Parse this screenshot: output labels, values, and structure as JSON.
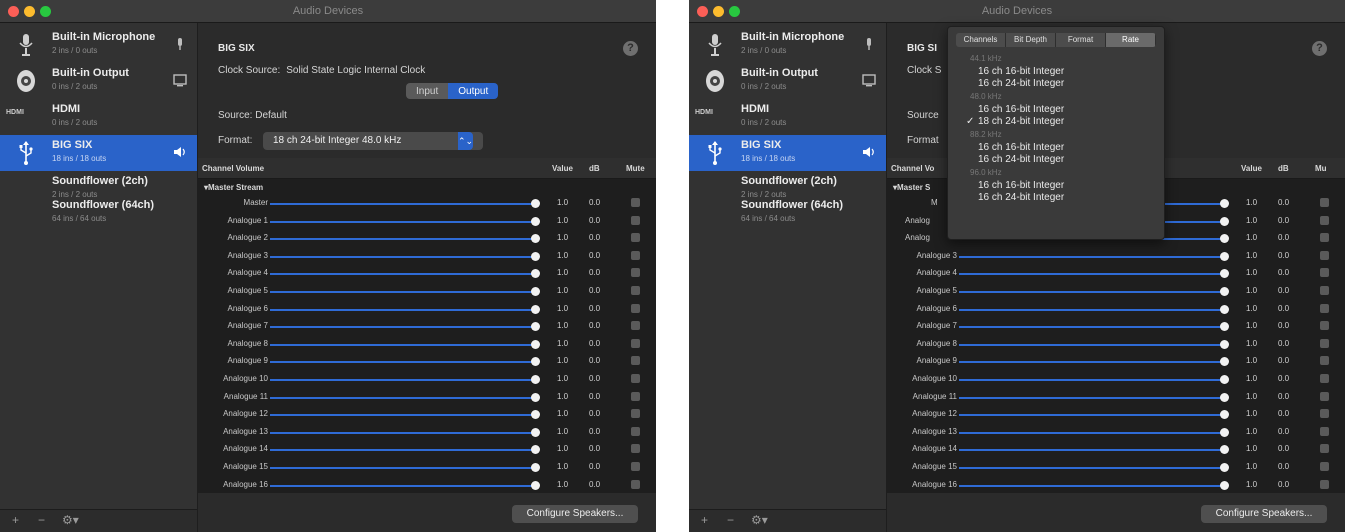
{
  "window_title": "Audio Devices",
  "devices": [
    {
      "name": "Built-in Microphone",
      "sub": "2 ins / 0 outs",
      "icon": "microphone-icon",
      "indicator": "mic-indicator-icon"
    },
    {
      "name": "Built-in Output",
      "sub": "0 ins / 2 outs",
      "icon": "speaker-icon",
      "indicator": "screen-indicator-icon"
    },
    {
      "name": "HDMI",
      "sub": "0 ins / 2 outs",
      "icon": "hdmi-icon",
      "icon_text": "HDMI"
    },
    {
      "name": "BIG SIX",
      "sub": "18 ins / 18 outs",
      "icon": "usb-icon",
      "indicator": "speaker-indicator-icon",
      "selected": true
    },
    {
      "name": "Soundflower (2ch)",
      "sub": "2 ins / 2 outs"
    },
    {
      "name": "Soundflower (64ch)",
      "sub": "64 ins / 64 outs"
    }
  ],
  "sidebar_bottom": {
    "add": "+",
    "remove": "−",
    "gear": "⚙▾"
  },
  "detail": {
    "device_title": "BIG SIX",
    "title_partial": "BIG SI",
    "help": "?",
    "clock_label": "Clock Source:",
    "clock_value": "Solid State Logic Internal Clock",
    "clock_partial": "Clock S",
    "tab_input": "Input",
    "tab_output": "Output",
    "source_label": "Source:",
    "source_value": "Default",
    "source_partial": "Source",
    "format_label": "Format:",
    "format_partial": "Format",
    "format_value": "18 ch 24-bit Integer 48.0 kHz",
    "format_arrow": "⌃⌄"
  },
  "table": {
    "col_channel": "Channel Volume",
    "col_channel_partial": "Channel Vo",
    "col_value": "Value",
    "col_db": "dB",
    "col_mute": "Mute",
    "col_mute_partial": "Mu",
    "group": "▾Master Stream",
    "group_partial": "▾Master S",
    "rows": [
      {
        "name": "Master",
        "value": "1.0",
        "db": "0.0",
        "partial": "M"
      },
      {
        "name": "Analogue 1",
        "value": "1.0",
        "db": "0.0",
        "partial": "Analog"
      },
      {
        "name": "Analogue 2",
        "value": "1.0",
        "db": "0.0",
        "partial": "Analog"
      },
      {
        "name": "Analogue 3",
        "value": "1.0",
        "db": "0.0"
      },
      {
        "name": "Analogue 4",
        "value": "1.0",
        "db": "0.0"
      },
      {
        "name": "Analogue 5",
        "value": "1.0",
        "db": "0.0"
      },
      {
        "name": "Analogue 6",
        "value": "1.0",
        "db": "0.0"
      },
      {
        "name": "Analogue 7",
        "value": "1.0",
        "db": "0.0"
      },
      {
        "name": "Analogue 8",
        "value": "1.0",
        "db": "0.0"
      },
      {
        "name": "Analogue 9",
        "value": "1.0",
        "db": "0.0"
      },
      {
        "name": "Analogue 10",
        "value": "1.0",
        "db": "0.0"
      },
      {
        "name": "Analogue 11",
        "value": "1.0",
        "db": "0.0"
      },
      {
        "name": "Analogue 12",
        "value": "1.0",
        "db": "0.0"
      },
      {
        "name": "Analogue 13",
        "value": "1.0",
        "db": "0.0"
      },
      {
        "name": "Analogue 14",
        "value": "1.0",
        "db": "0.0"
      },
      {
        "name": "Analogue 15",
        "value": "1.0",
        "db": "0.0"
      },
      {
        "name": "Analogue 16",
        "value": "1.0",
        "db": "0.0"
      }
    ],
    "volume_level": 1.0
  },
  "configure_button": "Configure Speakers...",
  "format_menu": {
    "tabs": [
      "Channels",
      "Bit Depth",
      "Format",
      "Rate"
    ],
    "active_tab": "Rate",
    "sections": [
      {
        "rate": "44.1 kHz",
        "items": [
          {
            "label": "16 ch 16-bit Integer"
          },
          {
            "label": "16 ch 24-bit Integer"
          }
        ]
      },
      {
        "rate": "48.0 kHz",
        "items": [
          {
            "label": "16 ch 16-bit Integer"
          },
          {
            "label": "18 ch 24-bit Integer",
            "checked": true
          }
        ]
      },
      {
        "rate": "88.2 kHz",
        "items": [
          {
            "label": "16 ch 16-bit Integer"
          },
          {
            "label": "16 ch 24-bit Integer"
          }
        ]
      },
      {
        "rate": "96.0 kHz",
        "items": [
          {
            "label": "16 ch 16-bit Integer"
          },
          {
            "label": "16 ch 24-bit Integer"
          }
        ]
      }
    ],
    "check": "✓"
  },
  "colors": {
    "accent": "#2a63c9",
    "slider": "#2f6bd6",
    "background": "#2b2b2b",
    "sidebar": "#323232",
    "table": "#1e1e1e"
  }
}
